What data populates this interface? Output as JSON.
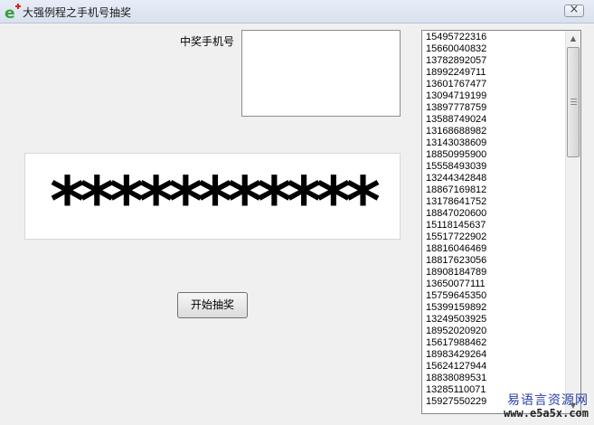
{
  "window": {
    "title": "大强例程之手机号抽奖",
    "close_label": "×"
  },
  "winner": {
    "label": "中奖手机号",
    "value": ""
  },
  "display": {
    "text": "***********"
  },
  "start_button": {
    "label": "开始抽奖"
  },
  "number_list": {
    "items": [
      "15495722316",
      "15660040832",
      "13782892057",
      "18992249711",
      "13601767477",
      "13094719199",
      "13897778759",
      "13588749024",
      "13168688982",
      "13143038609",
      "18850995900",
      "15558493039",
      "13244342848",
      "18867169812",
      "13178641752",
      "18847020600",
      "15118145637",
      "15517722902",
      "18816046469",
      "18817623056",
      "18908184789",
      "13650077111",
      "15759645350",
      "15399159892",
      "13249503925",
      "18952020920",
      "15617988462",
      "18983429264",
      "15624127944",
      "18838089531",
      "13285110071",
      "15927550229"
    ]
  },
  "watermark": {
    "top": "易语言资源网",
    "bottom": "www.e5a5x.com"
  },
  "colors": {
    "icon_green": "#33a33a",
    "icon_red": "#e01e1e",
    "watermark_blue": "#2a3fa8"
  }
}
